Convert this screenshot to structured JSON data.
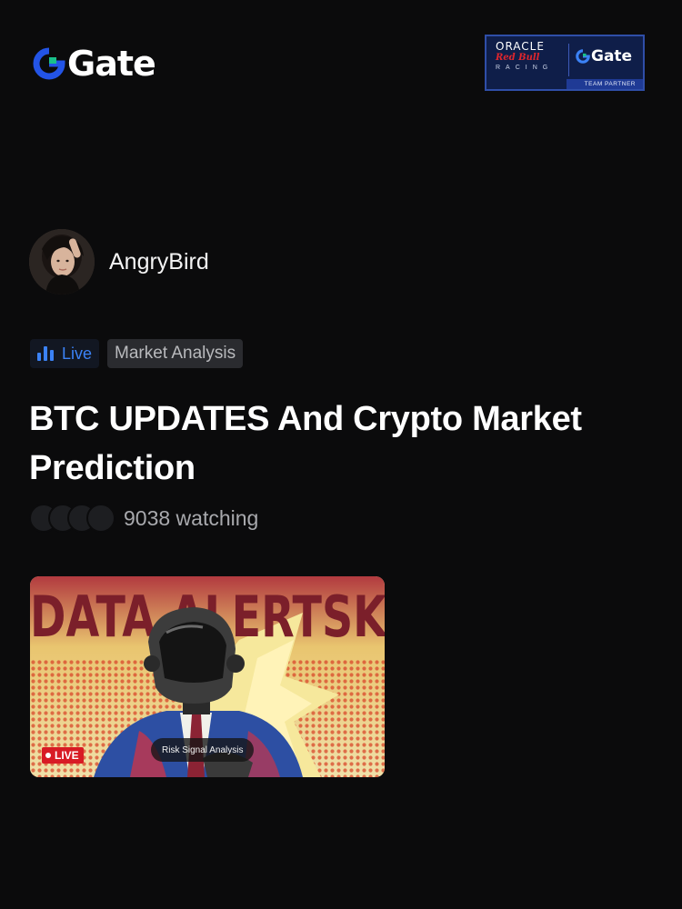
{
  "header": {
    "logo_text": "Gate",
    "logo_color": "#2354e6",
    "logo_accent": "#19c08a",
    "partner": {
      "oracle": "ORACLE",
      "redbull": "Red Bull",
      "racing": "RACING",
      "gate": "Gate",
      "team_partner": "TEAM PARTNER"
    }
  },
  "host": {
    "name": "AngryBird",
    "avatar_icon": "user-avatar-photo"
  },
  "tags": {
    "live": "Live",
    "category": "Market Analysis",
    "live_color": "#3b82f6"
  },
  "stream": {
    "title": "BTC UPDATES And Crypto Market Prediction",
    "watching": "9038 watching",
    "viewer_avatar_count": 4
  },
  "thumbnail": {
    "headline": "DATA ALERTSK",
    "live_badge": "LIVE",
    "caption": "Risk Signal Analysis"
  }
}
